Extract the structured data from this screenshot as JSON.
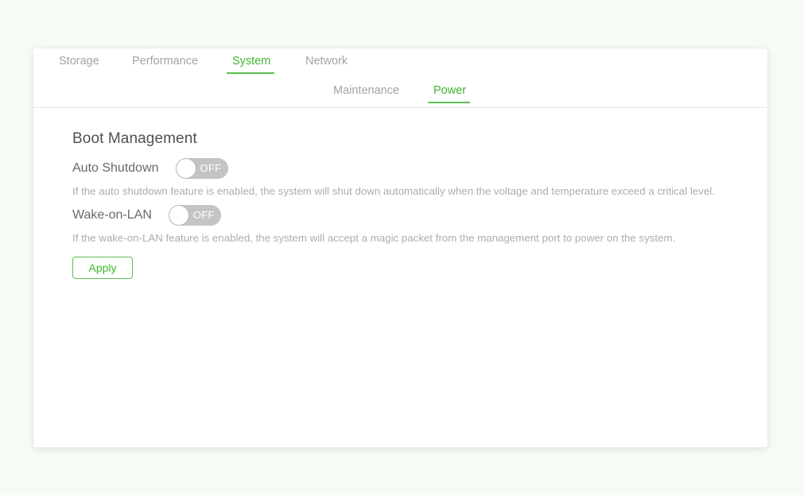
{
  "colors": {
    "accent": "#3fb62e",
    "accent_border": "#5cc150",
    "background": "#f6fbf4",
    "toggle_off": "#c4c4c4",
    "muted_text": "#a3a3a3"
  },
  "tabs": {
    "primary": [
      {
        "label": "Storage",
        "active": false
      },
      {
        "label": "Performance",
        "active": false
      },
      {
        "label": "System",
        "active": true
      },
      {
        "label": "Network",
        "active": false
      }
    ],
    "secondary": [
      {
        "label": "Maintenance",
        "active": false
      },
      {
        "label": "Power",
        "active": true
      }
    ]
  },
  "section": {
    "title": "Boot Management",
    "settings": [
      {
        "label": "Auto Shutdown",
        "toggle_state": "OFF",
        "description": "If the auto shutdown feature is enabled, the system will shut down automatically when the voltage and temperature exceed a critical level."
      },
      {
        "label": "Wake-on-LAN",
        "toggle_state": "OFF",
        "description": "If the wake-on-LAN feature is enabled, the system will accept a magic packet from the management port to power on the system."
      }
    ],
    "apply_label": "Apply"
  }
}
